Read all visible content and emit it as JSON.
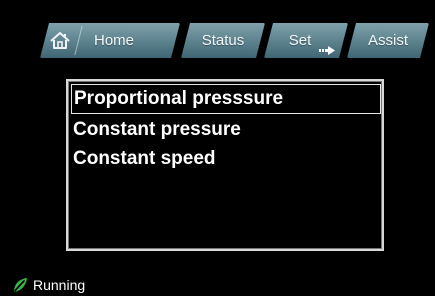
{
  "tabs": {
    "home": {
      "label": "Home",
      "icon": "home-icon"
    },
    "status": {
      "label": "Status"
    },
    "set": {
      "label": "Set",
      "icon": "arrow-right-icon"
    },
    "assist": {
      "label": "Assist"
    }
  },
  "menu": {
    "items": [
      {
        "label": "Proportional presssure",
        "selected": true
      },
      {
        "label": "Constant pressure",
        "selected": false
      },
      {
        "label": "Constant speed",
        "selected": false
      }
    ]
  },
  "status": {
    "label": "Running",
    "icon": "running-leaf-icon",
    "icon_color": "#3cb648"
  },
  "colors": {
    "tab_top": "#7fa1ab",
    "tab_bottom": "#3f6673",
    "background": "#000000",
    "text": "#ffffff"
  }
}
